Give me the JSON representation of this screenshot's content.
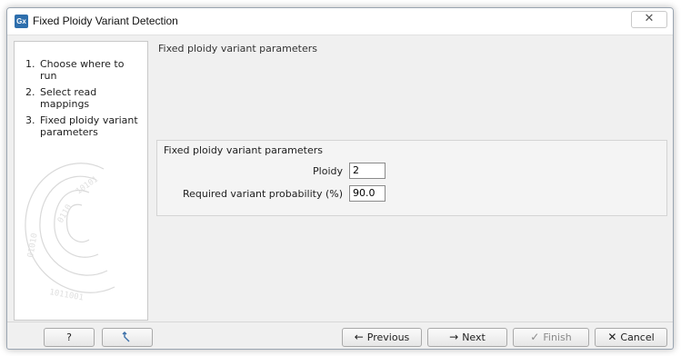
{
  "window": {
    "title": "Fixed Ploidy Variant Detection",
    "app_icon_text": "Gx",
    "close_glyph": "✕"
  },
  "steps": [
    {
      "number": "1.",
      "label": "Choose where to run"
    },
    {
      "number": "2.",
      "label": "Select read mappings"
    },
    {
      "number": "3.",
      "label": "Fixed ploidy variant parameters"
    }
  ],
  "panel": {
    "title": "Fixed ploidy variant parameters",
    "group_title": "Fixed ploidy variant parameters",
    "ploidy": {
      "label": "Ploidy",
      "value": "2"
    },
    "probability": {
      "label": "Required variant probability (%)",
      "value": "90.0"
    }
  },
  "buttons": {
    "help": "?",
    "previous": "Previous",
    "next": "Next",
    "finish": "Finish",
    "cancel": "Cancel"
  },
  "icons": {
    "help": "question-icon",
    "reset": "reset-arrow-icon",
    "previous": "arrow-left-icon",
    "next": "arrow-right-icon",
    "finish": "check-icon",
    "cancel": "x-icon"
  }
}
